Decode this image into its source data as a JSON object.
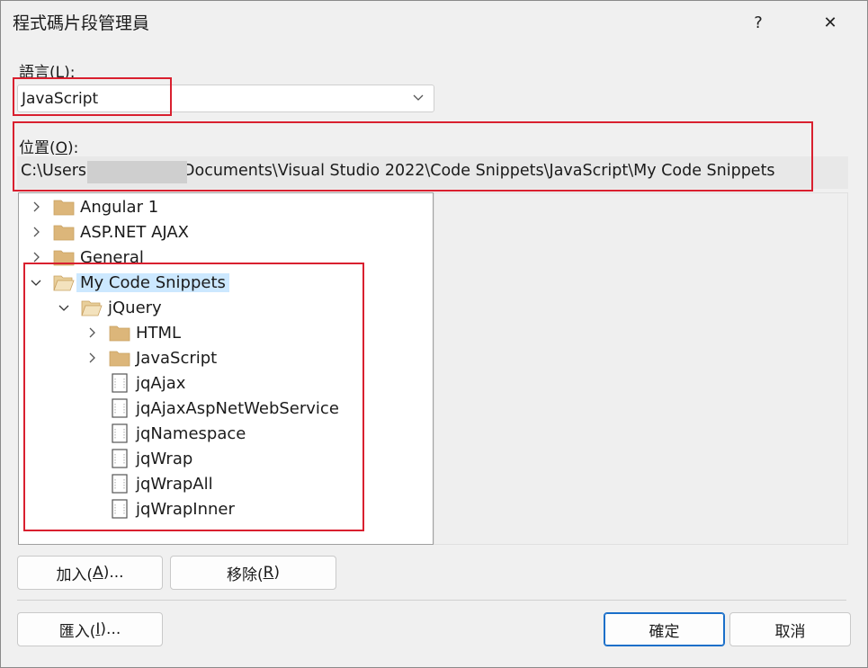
{
  "window": {
    "title": "程式碼片段管理員",
    "help": "?",
    "close": "✕"
  },
  "language": {
    "label": "語言(",
    "key": "L",
    "suffix": "):",
    "selected": "JavaScript"
  },
  "location": {
    "label": "位置(",
    "key": "O",
    "suffix": "):",
    "path_prefix": "C:\\Users",
    "path_suffix": "Documents\\Visual Studio 2022\\Code Snippets\\JavaScript\\My Code Snippets"
  },
  "tree": {
    "items": [
      {
        "label": "Angular 1",
        "type": "folder",
        "expand": "collapsed",
        "level": 0
      },
      {
        "label": "ASP.NET AJAX",
        "type": "folder",
        "expand": "collapsed",
        "level": 0
      },
      {
        "label": "General",
        "type": "folder",
        "expand": "collapsed",
        "level": 0
      },
      {
        "label": "My Code Snippets",
        "type": "folder-open",
        "expand": "expanded",
        "level": 0,
        "selected": true
      },
      {
        "label": "jQuery",
        "type": "folder-open",
        "expand": "expanded",
        "level": 1
      },
      {
        "label": "HTML",
        "type": "folder",
        "expand": "collapsed",
        "level": 2
      },
      {
        "label": "JavaScript",
        "type": "folder",
        "expand": "collapsed",
        "level": 2
      },
      {
        "label": "jqAjax",
        "type": "file",
        "expand": "none",
        "level": 2
      },
      {
        "label": "jqAjaxAspNetWebService",
        "type": "file",
        "expand": "none",
        "level": 2
      },
      {
        "label": "jqNamespace",
        "type": "file",
        "expand": "none",
        "level": 2
      },
      {
        "label": "jqWrap",
        "type": "file",
        "expand": "none",
        "level": 2
      },
      {
        "label": "jqWrapAll",
        "type": "file",
        "expand": "none",
        "level": 2
      },
      {
        "label": "jqWrapInner",
        "type": "file",
        "expand": "none",
        "level": 2
      }
    ]
  },
  "buttons": {
    "add": {
      "pre": "加入(",
      "key": "A",
      "post": ")..."
    },
    "remove": {
      "pre": "移除(",
      "key": "R",
      "post": ")"
    },
    "import": {
      "pre": "匯入(",
      "key": "I",
      "post": ")..."
    },
    "ok": "確定",
    "cancel": "取消"
  },
  "colors": {
    "highlight": "#d9202f",
    "selection": "#cce8ff",
    "folder": "#dcb67a",
    "accent": "#1a6fc9"
  }
}
